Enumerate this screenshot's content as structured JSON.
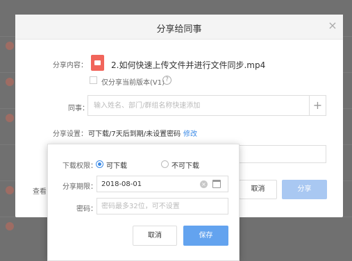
{
  "dialog": {
    "title": "分享给同事",
    "close_icon": "close-icon",
    "content_label": "分享内容：",
    "file_name": "2.如何快速上传文件并进行文件同步.mp4",
    "file_icon": "video-file-icon",
    "share_current_version_label": "仅分享当前版本(V1)",
    "help_icon": "question-mark-icon",
    "coworker_label": "同事：",
    "coworker_placeholder": "输入姓名、部门/群组名称快速添加",
    "add_icon": "plus-icon",
    "settings_label": "分享设置：",
    "settings_value": "可下载/7天后到期/未设置密码",
    "modify_link": "修改",
    "view_label": "查看",
    "cancel_label": "取消",
    "share_label": "分享"
  },
  "popup": {
    "download_permission_label": "下载权限：",
    "option_downloadable": "可下载",
    "option_not_downloadable": "不可下载",
    "selected_option": "可下载",
    "expiry_label": "分享期限：",
    "expiry_value": "2018-08-01",
    "password_label": "密码：",
    "password_placeholder": "密码最多32位，可不设置",
    "cancel_label": "取消",
    "save_label": "保存"
  },
  "colors": {
    "primary": "#3b8ae6",
    "save_button": "#63a3ef",
    "share_button_disabled": "#a9c8f2",
    "video_icon": "#f1655b"
  }
}
